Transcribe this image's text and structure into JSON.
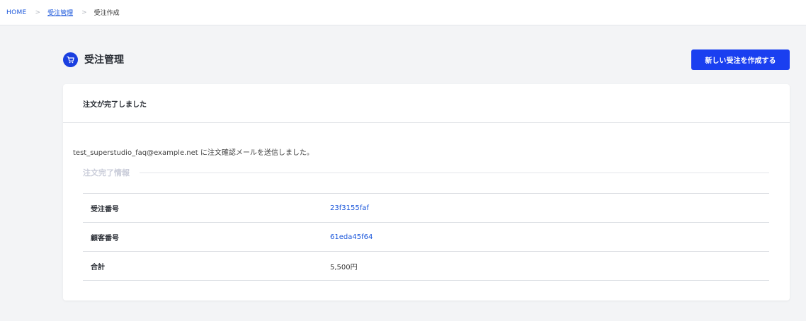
{
  "breadcrumb": {
    "home": "HOME",
    "sep1": ">",
    "parent": "受注管理",
    "sep2": ">",
    "current": "受注作成"
  },
  "header": {
    "title": "受注管理",
    "create_button": "新しい受注を作成する",
    "icon": "shopping-cart-icon"
  },
  "card": {
    "title": "注文が完了しました",
    "notice": "test_superstudio_faq@example.net に注文確認メールを送信しました。",
    "section_title": "注文完了情報",
    "rows": [
      {
        "label": "受注番号",
        "value": "23f3155faf"
      },
      {
        "label": "顧客番号",
        "value": "61eda45f64"
      },
      {
        "label": "合計",
        "value": "5,500円"
      }
    ]
  },
  "colors": {
    "accent": "#1a3ff0",
    "link": "#1a56db",
    "background": "#f3f4f6"
  }
}
